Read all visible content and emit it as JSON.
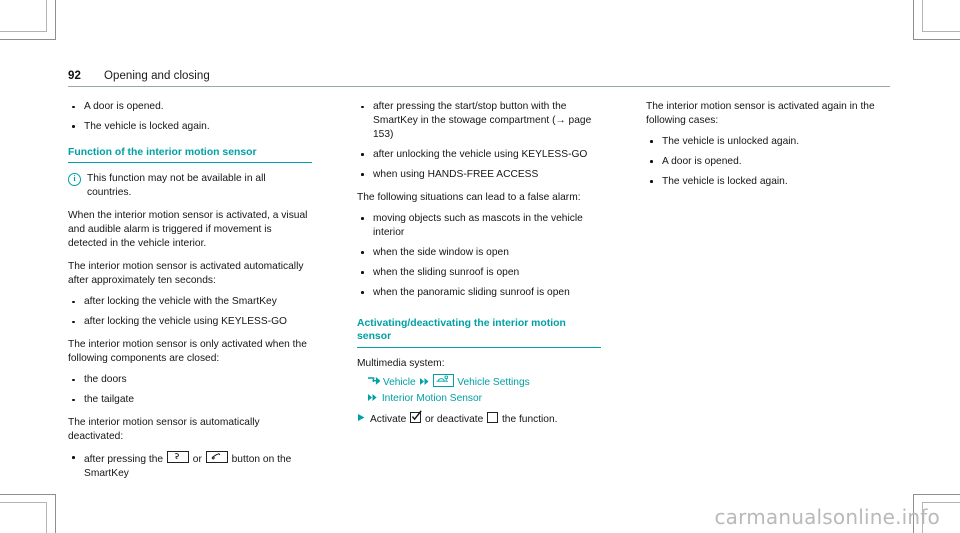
{
  "header": {
    "page_number": "92",
    "section_title": "Opening and closing"
  },
  "left_column": {
    "top_bullets": [
      "A door is opened.",
      "The vehicle is locked again."
    ],
    "heading": "Function of the interior motion sensor",
    "note_icon": "info-circle-icon",
    "note_text": "This function may not be available in all countries.",
    "para_1": "When the interior motion sensor is activated, a visual and audible alarm is triggered if movement is detected in the vehicle interior.",
    "para_2": "The interior motion sensor is activated automatically after approximately ten seconds:",
    "bullets_2": [
      "after locking the vehicle with the SmartKey",
      "after locking the vehicle using KEYLESS-GO"
    ],
    "para_3": "The interior motion sensor is only activated when the following components are closed:",
    "bullets_3": [
      "the doors",
      "the tailgate"
    ],
    "para_4": "The interior motion sensor is automatically deactivated:",
    "deactivate_bullet": {
      "text_before": "after pressing the",
      "icon_1": "smartkey-lock-button-icon",
      "text_middle": "or",
      "icon_2": "smartkey-unlock-button-icon",
      "text_after": "button on the SmartKey"
    }
  },
  "middle_column": {
    "bullets_1": [
      "after pressing the start/stop button with the SmartKey in the stowage compartment (→ page 153)",
      "after unlocking the vehicle using KEYLESS-GO",
      "when using HANDS-FREE ACCESS"
    ],
    "para_1": "The following situations can lead to a false alarm:",
    "bullets_2": [
      "moving objects such as mascots in the vehicle interior",
      "when the side window is open",
      "when the sliding sunroof is open",
      "when the panoramic sliding sunroof is open"
    ],
    "heading": "Activating/deactivating the interior motion sensor",
    "multimedia_label": "Multimedia system:",
    "nav_path": {
      "entry_icon": "menu-entry-arrow-icon",
      "item_1": "Vehicle",
      "sep_icon_1": "double-chevron-right-icon",
      "settings_icon": "vehicle-settings-car-icon",
      "item_2": "Vehicle Settings",
      "sep_icon_2": "double-chevron-right-icon",
      "item_3": "Interior Motion Sensor"
    },
    "action_step": {
      "arrow_icon": "triangle-right-icon",
      "text_before": "Activate",
      "checked_icon": "checkbox-checked-icon",
      "text_middle": "or deactivate",
      "unchecked_icon": "checkbox-empty-icon",
      "text_after": "the function."
    }
  },
  "right_column": {
    "para_1": "The interior motion sensor is activated again in the following cases:",
    "bullets_1": [
      "The vehicle is unlocked again.",
      "A door is opened.",
      "The vehicle is locked again."
    ]
  },
  "watermark": {
    "text": "carmanualsonline.info"
  },
  "colors": {
    "accent_teal": "#00a0a6",
    "body_text": "#151515",
    "rule_gray": "#9aa7a8",
    "watermark_gray": "#b9b9b9"
  }
}
